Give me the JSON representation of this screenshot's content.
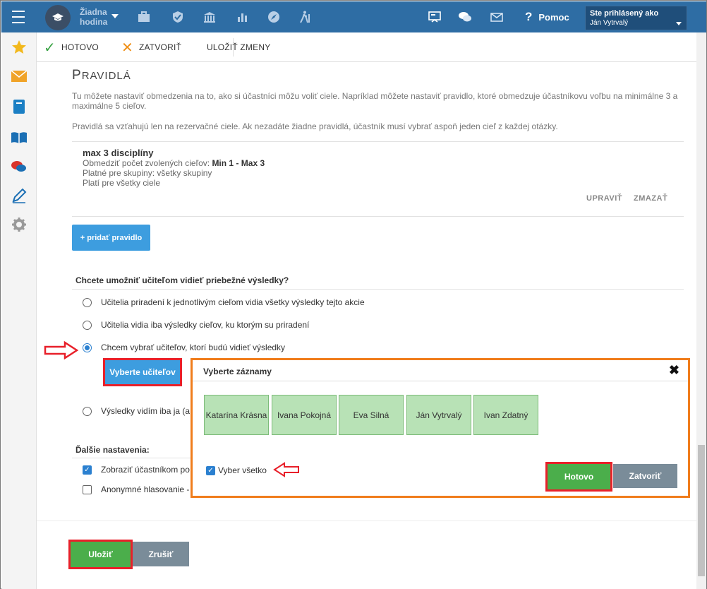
{
  "topbar": {
    "hour_label": "Žiadna hodina",
    "help_label": "Pomoc",
    "user_caption": "Ste prihlásený ako",
    "user_name": "Ján Vytrvalý"
  },
  "toolbar": {
    "done_label": "HOTOVO",
    "close_label": "ZATVORIŤ",
    "save_changes_label": "ULOŽIŤ ZMENY"
  },
  "rules": {
    "title_first": "P",
    "title_rest": "RAVIDLÁ",
    "intro": "Tu môžete nastaviť obmedzenia na to, ako si účastníci môžu voliť ciele. Napríklad môžete nastaviť pravidlo, ktoré obmedzuje účastníkovu voľbu na minimálne 3 a maximálne 5 cieľov.",
    "note": "Pravidlá sa vzťahujú len na rezervačné ciele. Ak nezadáte žiadne pravidlá, účastník musí vybrať aspoň jeden cieľ z každej otázky.",
    "item": {
      "name": "max 3 disciplíny",
      "limit_prefix": "Obmedziť počet zvolených cieľov:",
      "limit_value": "Min 1 - Max 3",
      "groups": "Platné pre skupiny: všetky skupiny",
      "targets": "Platí pre všetky ciele",
      "edit_label": "UPRAVIŤ",
      "delete_label": "ZMAZAŤ"
    },
    "add_label": "+ pridať pravidlo"
  },
  "results": {
    "question": "Chcete umožniť učiteľom vidieť priebežné výsledky?",
    "options": [
      "Učitelia priradení k jednotlivým cieľom vidia všetky výsledky tejto akcie",
      "Učitelia vidia iba výsledky cieľov, ku ktorým su priradení",
      "Chcem vybrať učiteľov, ktorí budú vidieť výsledky",
      "Výsledky vidím iba ja (a"
    ],
    "selected_index": 2,
    "select_teachers_label": "Vyberte učiteľov"
  },
  "more": {
    "heading": "Ďalšie nastavenia:",
    "options": [
      {
        "label": "Zobraziť účastníkom po",
        "checked": true
      },
      {
        "label": "Anonymné hlasovanie -",
        "checked": false
      }
    ]
  },
  "footer": {
    "save_label": "Uložiť",
    "cancel_label": "Zrušiť"
  },
  "modal": {
    "title": "Vyberte záznamy",
    "close_glyph": "✖",
    "records": [
      "Katarína Krásna",
      "Ivana Pokojná",
      "Eva Silná",
      "Ján Vytrvalý",
      "Ivan Zdatný"
    ],
    "select_all_label": "Vyber všetko",
    "select_all_checked": true,
    "ok_label": "Hotovo",
    "cancel_label": "Zatvoriť"
  },
  "colors": {
    "topbar": "#2e6da4",
    "primary": "#3d9ddf",
    "success": "#4bae4b",
    "highlight": "#e8202a",
    "modal_border": "#f07d1c"
  },
  "icons": [
    "menu-icon",
    "graduation-cap-icon",
    "briefcase-icon",
    "shield-icon",
    "bank-icon",
    "bar-chart-icon",
    "compass-icon",
    "hiking-icon",
    "presentation-icon",
    "chat-icon",
    "mail-icon",
    "help-icon",
    "star-icon",
    "envelope-icon",
    "book-icon",
    "open-book-icon",
    "comments-icon",
    "pen-icon",
    "gear-icon",
    "chevron-right-icon"
  ]
}
